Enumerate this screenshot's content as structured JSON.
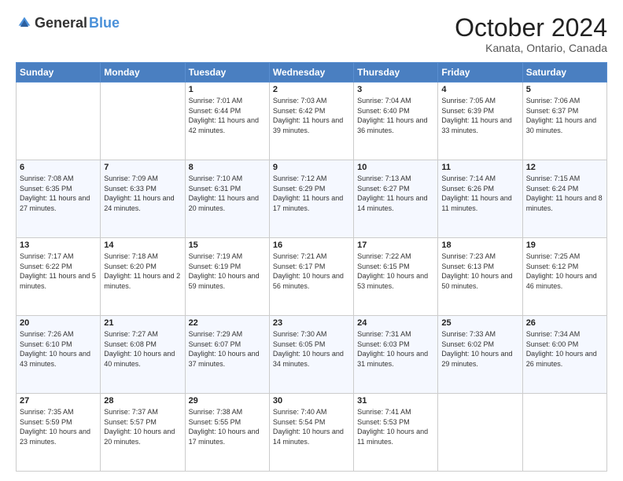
{
  "header": {
    "logo_general": "General",
    "logo_blue": "Blue",
    "month_title": "October 2024",
    "location": "Kanata, Ontario, Canada"
  },
  "weekdays": [
    "Sunday",
    "Monday",
    "Tuesday",
    "Wednesday",
    "Thursday",
    "Friday",
    "Saturday"
  ],
  "weeks": [
    [
      {
        "day": "",
        "content": ""
      },
      {
        "day": "",
        "content": ""
      },
      {
        "day": "1",
        "content": "Sunrise: 7:01 AM\nSunset: 6:44 PM\nDaylight: 11 hours and 42 minutes."
      },
      {
        "day": "2",
        "content": "Sunrise: 7:03 AM\nSunset: 6:42 PM\nDaylight: 11 hours and 39 minutes."
      },
      {
        "day": "3",
        "content": "Sunrise: 7:04 AM\nSunset: 6:40 PM\nDaylight: 11 hours and 36 minutes."
      },
      {
        "day": "4",
        "content": "Sunrise: 7:05 AM\nSunset: 6:39 PM\nDaylight: 11 hours and 33 minutes."
      },
      {
        "day": "5",
        "content": "Sunrise: 7:06 AM\nSunset: 6:37 PM\nDaylight: 11 hours and 30 minutes."
      }
    ],
    [
      {
        "day": "6",
        "content": "Sunrise: 7:08 AM\nSunset: 6:35 PM\nDaylight: 11 hours and 27 minutes."
      },
      {
        "day": "7",
        "content": "Sunrise: 7:09 AM\nSunset: 6:33 PM\nDaylight: 11 hours and 24 minutes."
      },
      {
        "day": "8",
        "content": "Sunrise: 7:10 AM\nSunset: 6:31 PM\nDaylight: 11 hours and 20 minutes."
      },
      {
        "day": "9",
        "content": "Sunrise: 7:12 AM\nSunset: 6:29 PM\nDaylight: 11 hours and 17 minutes."
      },
      {
        "day": "10",
        "content": "Sunrise: 7:13 AM\nSunset: 6:27 PM\nDaylight: 11 hours and 14 minutes."
      },
      {
        "day": "11",
        "content": "Sunrise: 7:14 AM\nSunset: 6:26 PM\nDaylight: 11 hours and 11 minutes."
      },
      {
        "day": "12",
        "content": "Sunrise: 7:15 AM\nSunset: 6:24 PM\nDaylight: 11 hours and 8 minutes."
      }
    ],
    [
      {
        "day": "13",
        "content": "Sunrise: 7:17 AM\nSunset: 6:22 PM\nDaylight: 11 hours and 5 minutes."
      },
      {
        "day": "14",
        "content": "Sunrise: 7:18 AM\nSunset: 6:20 PM\nDaylight: 11 hours and 2 minutes."
      },
      {
        "day": "15",
        "content": "Sunrise: 7:19 AM\nSunset: 6:19 PM\nDaylight: 10 hours and 59 minutes."
      },
      {
        "day": "16",
        "content": "Sunrise: 7:21 AM\nSunset: 6:17 PM\nDaylight: 10 hours and 56 minutes."
      },
      {
        "day": "17",
        "content": "Sunrise: 7:22 AM\nSunset: 6:15 PM\nDaylight: 10 hours and 53 minutes."
      },
      {
        "day": "18",
        "content": "Sunrise: 7:23 AM\nSunset: 6:13 PM\nDaylight: 10 hours and 50 minutes."
      },
      {
        "day": "19",
        "content": "Sunrise: 7:25 AM\nSunset: 6:12 PM\nDaylight: 10 hours and 46 minutes."
      }
    ],
    [
      {
        "day": "20",
        "content": "Sunrise: 7:26 AM\nSunset: 6:10 PM\nDaylight: 10 hours and 43 minutes."
      },
      {
        "day": "21",
        "content": "Sunrise: 7:27 AM\nSunset: 6:08 PM\nDaylight: 10 hours and 40 minutes."
      },
      {
        "day": "22",
        "content": "Sunrise: 7:29 AM\nSunset: 6:07 PM\nDaylight: 10 hours and 37 minutes."
      },
      {
        "day": "23",
        "content": "Sunrise: 7:30 AM\nSunset: 6:05 PM\nDaylight: 10 hours and 34 minutes."
      },
      {
        "day": "24",
        "content": "Sunrise: 7:31 AM\nSunset: 6:03 PM\nDaylight: 10 hours and 31 minutes."
      },
      {
        "day": "25",
        "content": "Sunrise: 7:33 AM\nSunset: 6:02 PM\nDaylight: 10 hours and 29 minutes."
      },
      {
        "day": "26",
        "content": "Sunrise: 7:34 AM\nSunset: 6:00 PM\nDaylight: 10 hours and 26 minutes."
      }
    ],
    [
      {
        "day": "27",
        "content": "Sunrise: 7:35 AM\nSunset: 5:59 PM\nDaylight: 10 hours and 23 minutes."
      },
      {
        "day": "28",
        "content": "Sunrise: 7:37 AM\nSunset: 5:57 PM\nDaylight: 10 hours and 20 minutes."
      },
      {
        "day": "29",
        "content": "Sunrise: 7:38 AM\nSunset: 5:55 PM\nDaylight: 10 hours and 17 minutes."
      },
      {
        "day": "30",
        "content": "Sunrise: 7:40 AM\nSunset: 5:54 PM\nDaylight: 10 hours and 14 minutes."
      },
      {
        "day": "31",
        "content": "Sunrise: 7:41 AM\nSunset: 5:53 PM\nDaylight: 10 hours and 11 minutes."
      },
      {
        "day": "",
        "content": ""
      },
      {
        "day": "",
        "content": ""
      }
    ]
  ]
}
